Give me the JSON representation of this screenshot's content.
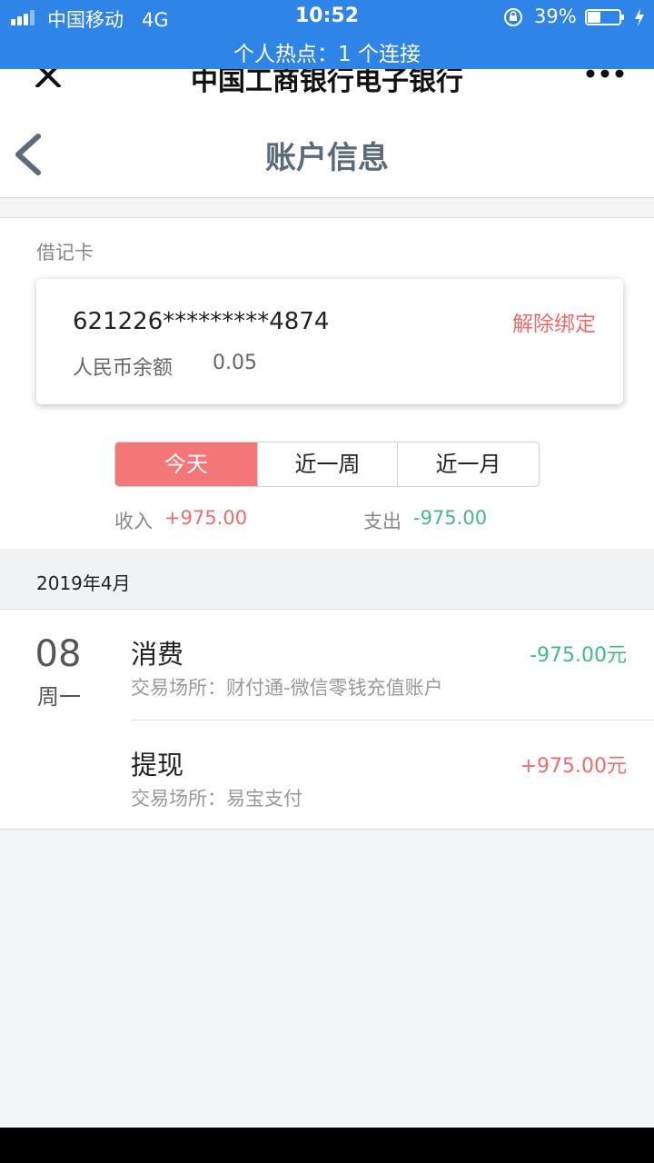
{
  "status_bar": {
    "carrier": "中国移动",
    "network": "4G",
    "time": "10:52",
    "battery": "39%",
    "hotspot": "个人热点：1 个连接",
    "bar_color": "#2f84e8"
  },
  "nav": {
    "title": "中国工商银行电子银行"
  },
  "header": {
    "title": "账户信息"
  },
  "account": {
    "card_type": "借记卡",
    "card_number": "621226*********4874",
    "unbind_label": "解除绑定",
    "balance_label": "人民币余额",
    "balance": "0.05"
  },
  "range_tabs": [
    {
      "label": "今天",
      "active": true
    },
    {
      "label": "近一周",
      "active": false
    },
    {
      "label": "近一月",
      "active": false
    }
  ],
  "summary": {
    "income_label": "收入",
    "income": "+975.00",
    "expense_label": "支出",
    "expense": "-975.00"
  },
  "month": "2019年4月",
  "day_group": {
    "day": "08",
    "weekday": "周一",
    "transactions": [
      {
        "title": "消费",
        "place": "交易场所：财付通-微信零钱充值账户",
        "amount": "-975.00元",
        "type": "expense"
      },
      {
        "title": "提现",
        "place": "交易场所：易宝支付",
        "amount": "+975.00元",
        "type": "income"
      }
    ]
  },
  "colors": {
    "accent_red": "#f57678",
    "income_red": "#f06b6b",
    "expense_green": "#43b98a"
  }
}
